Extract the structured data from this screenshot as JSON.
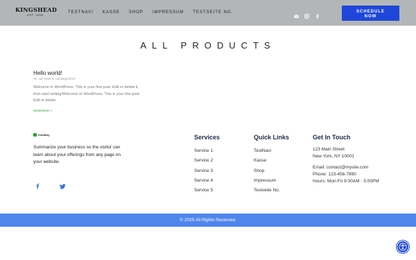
{
  "header": {
    "logo": {
      "name": "KINGSHEAD",
      "tagline": "EST 1966"
    },
    "nav": [
      "TESTNAVI",
      "KASSE",
      "SHOP",
      "IMPRESSUM",
      "TESTSEITE NO."
    ],
    "social_icons": [
      "email-icon",
      "instagram-icon",
      "facebook-icon"
    ],
    "cta_line1": "SCHEDULE",
    "cta_line2": "NOW",
    "background": "#b3b6b7",
    "accent": "#1e47d9"
  },
  "main": {
    "title": "ALL PRODUCTS",
    "post": {
      "title": "Hello world!",
      "meta": "25. Juli 2025 in Uncategorized",
      "excerpt": "Welcome to WordPress. This is your first post. Edit or delete it, then start writing!Welcome to WordPress. This is your first post. Edit or delete",
      "more": "Weiterlesen »"
    }
  },
  "footer": {
    "brand": "KetoBuy",
    "summary": "Summarize your business so the visitor can learn about your offerings from any page on your website.",
    "social_icons": [
      "facebook-icon",
      "twitter-icon"
    ],
    "services": {
      "heading": "Services",
      "items": [
        "Service 1",
        "Service 2",
        "Service 3",
        "Service 4",
        "Service 5"
      ]
    },
    "quick_links": {
      "heading": "Quick Links",
      "items": [
        "TestNavi",
        "Kasse",
        "Shop",
        "Impressum",
        "Testseite No."
      ]
    },
    "contact": {
      "heading": "Get In Touch",
      "address1": "123 Main Street",
      "address2": "New York, NY 10001",
      "email": "Email: contact@mysite.com",
      "phone": "Phone: 123-456-7890",
      "hours": "Hours: Mon-Fri 9:00AM - 5:00PM"
    },
    "copyright": "© 2025 All Rights Reserved.",
    "bar_color": "#4f86ec"
  },
  "accessibility_icon": "accessibility-icon"
}
